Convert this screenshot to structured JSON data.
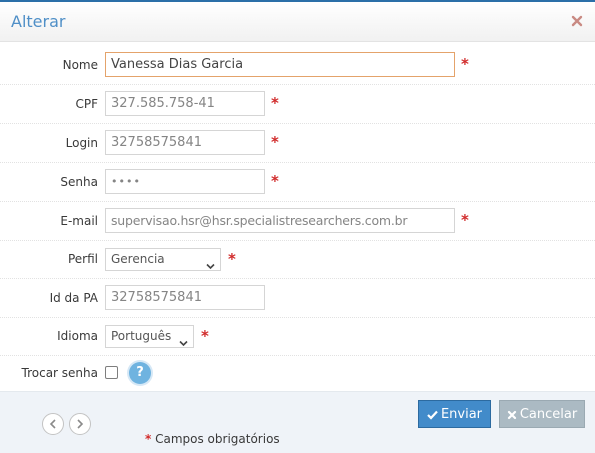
{
  "modal": {
    "title": "Alterar"
  },
  "form": {
    "nome": {
      "label": "Nome",
      "value": "Vanessa Dias Garcia",
      "required_mark": "*"
    },
    "cpf": {
      "label": "CPF",
      "value": "327.585.758-41",
      "required_mark": "*"
    },
    "login": {
      "label": "Login",
      "value": "32758575841",
      "required_mark": "*"
    },
    "senha": {
      "label": "Senha",
      "value": "••••",
      "required_mark": "*"
    },
    "email": {
      "label": "E-mail",
      "value": "supervisao.hsr@hsr.specialistresearchers.com.br",
      "required_mark": "*"
    },
    "perfil": {
      "label": "Perfil",
      "value": "Gerencia",
      "required_mark": "*"
    },
    "id_pa": {
      "label": "Id da PA",
      "value": "32758575841"
    },
    "idioma": {
      "label": "Idioma",
      "value": "Português",
      "required_mark": "*"
    },
    "trocar_senha": {
      "label": "Trocar senha",
      "checked": false,
      "help_text": "?"
    }
  },
  "footer": {
    "submit_label": "Enviar",
    "cancel_label": "Cancelar",
    "required_star": "*",
    "required_note": "Campos obrigatórios"
  },
  "colors": {
    "primary": "#428bca",
    "cancel": "#abbac3",
    "title": "#4f8fc7",
    "required": "#d12b2b",
    "focus_border": "#e4a36b"
  },
  "icons": {
    "close": "close-icon",
    "submit": "check-icon",
    "cancel": "x-icon",
    "prev": "chevron-left-icon",
    "next": "chevron-right-icon",
    "help": "question-icon"
  }
}
